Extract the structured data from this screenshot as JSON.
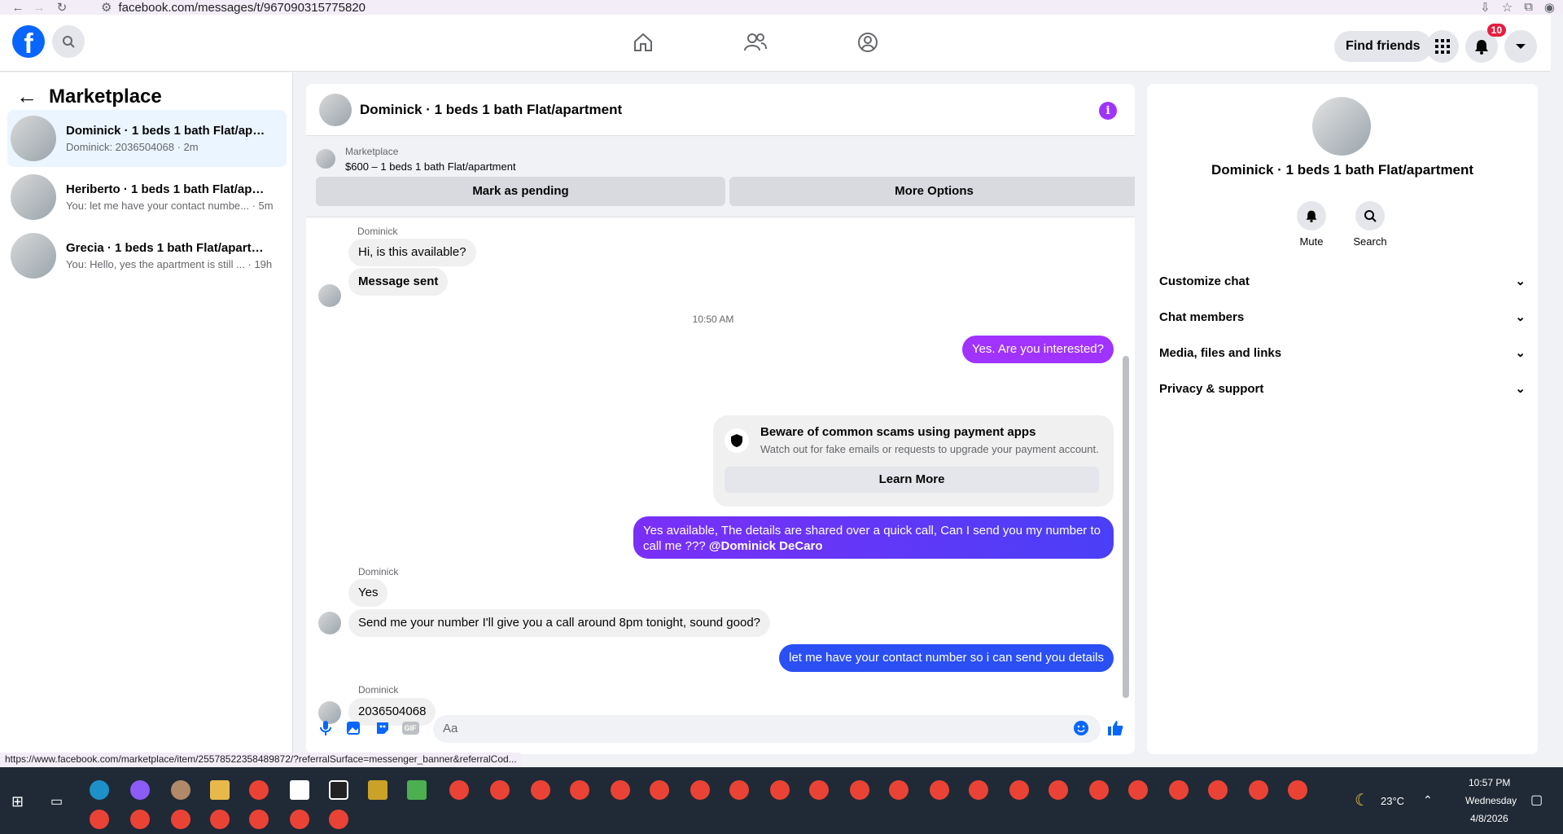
{
  "browser": {
    "url": "facebook.com/messages/t/967090315775820"
  },
  "header": {
    "find_friends": "Find friends",
    "notifications_count": "10"
  },
  "left": {
    "title": "Marketplace",
    "conversations": [
      {
        "title": "Dominick · 1 beds 1 bath Flat/apart...",
        "preview": "Dominick: 2036504068 · 2m"
      },
      {
        "title": "Heriberto · 1 beds 1 bath Flat/apar...",
        "preview": "You: let me have your contact numbe... · 5m"
      },
      {
        "title": "Grecia · 1 beds 1 bath Flat/apartme...",
        "preview": "You: Hello, yes the apartment is still ... · 19h"
      }
    ]
  },
  "chat": {
    "title": "Dominick · 1 beds 1 bath Flat/apartment",
    "marketplace_label": "Marketplace",
    "listing": "$600 – 1 beds 1 bath Flat/apartment",
    "mark_pending": "Mark as pending",
    "more_options": "More Options",
    "messages": {
      "sender1": "Dominick",
      "m1": "Hi, is this available?",
      "m2": "Message sent",
      "time": "10:50 AM",
      "m3": "Yes. Are you interested?",
      "scam_title": "Beware of common scams using payment apps",
      "scam_sub": "Watch out for fake emails or requests to upgrade your payment account.",
      "learn_more": "Learn More",
      "m4_line1": "Yes available, The details are shared over a quick call, Can I send you my number to",
      "m4_line2": "call me ??? ",
      "m4_mention": "@Dominick DeCaro",
      "sender2": "Dominick",
      "m5": "Yes",
      "m6": "Send me your number I'll give you a call around 8pm tonight, sound good?",
      "m7": "let me have your contact number so i can send you details",
      "sender3": "Dominick",
      "m8": "2036504068"
    },
    "input_placeholder": "Aa",
    "colors": {
      "purple": "#a033ff",
      "blue": "#0866ff"
    }
  },
  "right": {
    "title": "Dominick · 1 beds 1 bath Flat/apartment",
    "mute": "Mute",
    "search": "Search",
    "sections": [
      "Customize chat",
      "Chat members",
      "Media, files and links",
      "Privacy & support"
    ]
  },
  "status_url": "https://www.facebook.com/marketplace/item/2557852235848​9872/?referralSurface=messenger_banner&referralCod...",
  "taskbar": {
    "weather": "23°C",
    "time": "10:57 PM",
    "day": "Wednesday",
    "date": "4/8/2026"
  }
}
